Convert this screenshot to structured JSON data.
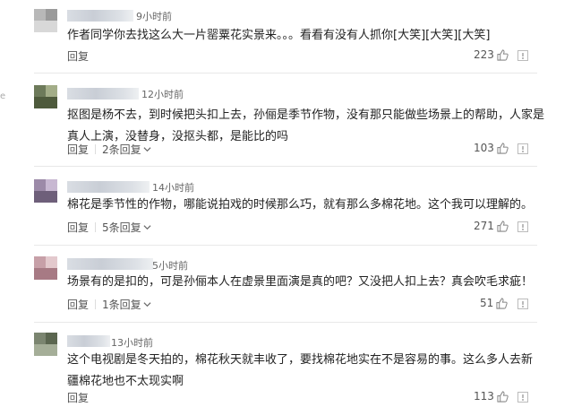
{
  "comments": [
    {
      "time": "9小时前",
      "text": "作者同学你去找这么大一片罂粟花实景来。。。看看有没有人抓你[大笑][大笑][大笑]",
      "reply_label": "回复",
      "replies_label": "",
      "likes": "223",
      "avatar_colors": [
        "#b8b8b8",
        "#9a9a9a",
        "#d8d8d8"
      ]
    },
    {
      "time": "12小时前",
      "text": "抠图是杨不去，到时候把头扣上去，孙俪是季节作物，没有那只能做些场景上的帮助，人家是真人上演，没替身，没抠头都，是能比的吗",
      "reply_label": "回复",
      "replies_label": "2条回复",
      "likes": "103",
      "avatar_colors": [
        "#6d7a5a",
        "#a3ad88",
        "#4e5a3c"
      ]
    },
    {
      "time": "14小时前",
      "text": "棉花是季节性的作物，哪能说拍戏的时候那么巧，就有那么多棉花地。这个我可以理解的。",
      "reply_label": "回复",
      "replies_label": "5条回复",
      "likes": "271",
      "avatar_colors": [
        "#9c8aa8",
        "#c8b8d2",
        "#6e5f7a"
      ]
    },
    {
      "time": "5小时前",
      "text": "场景有的是扣的，可是孙俪本人在虚景里面演是真的吧？又没把人扣上去？真会吹毛求疵！",
      "reply_label": "回复",
      "replies_label": "1条回复",
      "likes": "51",
      "avatar_colors": [
        "#c7a0a8",
        "#e3c9cd",
        "#a77a84"
      ]
    },
    {
      "time": "13小时前",
      "text": "这个电视剧是冬天拍的，棉花秋天就丰收了，要找棉花地实在不是容易的事。这么多人去新疆棉花地也不太现实啊",
      "reply_label": "回复",
      "replies_label": "",
      "likes": "113",
      "avatar_colors": [
        "#7b8570",
        "#5b6650",
        "#a5ae98"
      ]
    }
  ],
  "edge_mark": "e",
  "icons": {
    "like": "thumbs-up-icon",
    "report": "report-icon"
  }
}
